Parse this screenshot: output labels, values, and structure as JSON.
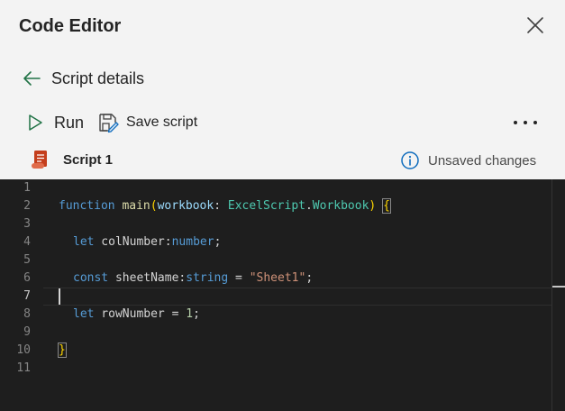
{
  "header": {
    "title": "Code Editor"
  },
  "nav": {
    "back_label": "Script details"
  },
  "toolbar": {
    "run_label": "Run",
    "save_label": "Save script"
  },
  "script": {
    "name": "Script 1",
    "status": "Unsaved changes"
  },
  "colors": {
    "accent_green": "#217346",
    "script_icon": "#c43e1c",
    "info_blue": "#0f6cbd",
    "editor_bg": "#1e1e1e"
  },
  "icons": {
    "close": "close-icon",
    "back": "arrow-left-icon",
    "run": "play-icon",
    "save": "save-icon",
    "more": "more-horizontal-icon",
    "script": "script-scroll-icon",
    "info": "info-icon"
  },
  "editor": {
    "active_line": 7,
    "line_numbers": [
      "1",
      "2",
      "3",
      "4",
      "5",
      "6",
      "7",
      "8",
      "9",
      "10",
      "11"
    ],
    "lines": {
      "l2": {
        "kw": "function",
        "fn": "main",
        "open_paren": "(",
        "param": "workbook",
        "colon": ": ",
        "type1": "ExcelScript",
        "dot": ".",
        "type2": "Workbook",
        "close_paren": ")",
        "space": " ",
        "brace": "{"
      },
      "l4": {
        "kw": "let",
        "var": " colNumber",
        "colon": ":",
        "type": "number",
        "semi": ";"
      },
      "l6": {
        "kw": "const",
        "var": " sheetName",
        "colon": ":",
        "type": "string",
        "eq": " = ",
        "str": "\"Sheet1\"",
        "semi": ";"
      },
      "l8": {
        "kw": "let",
        "var": " rowNumber",
        "eq": " = ",
        "num": "1",
        "semi": ";"
      },
      "l10": {
        "brace": "}"
      }
    }
  }
}
